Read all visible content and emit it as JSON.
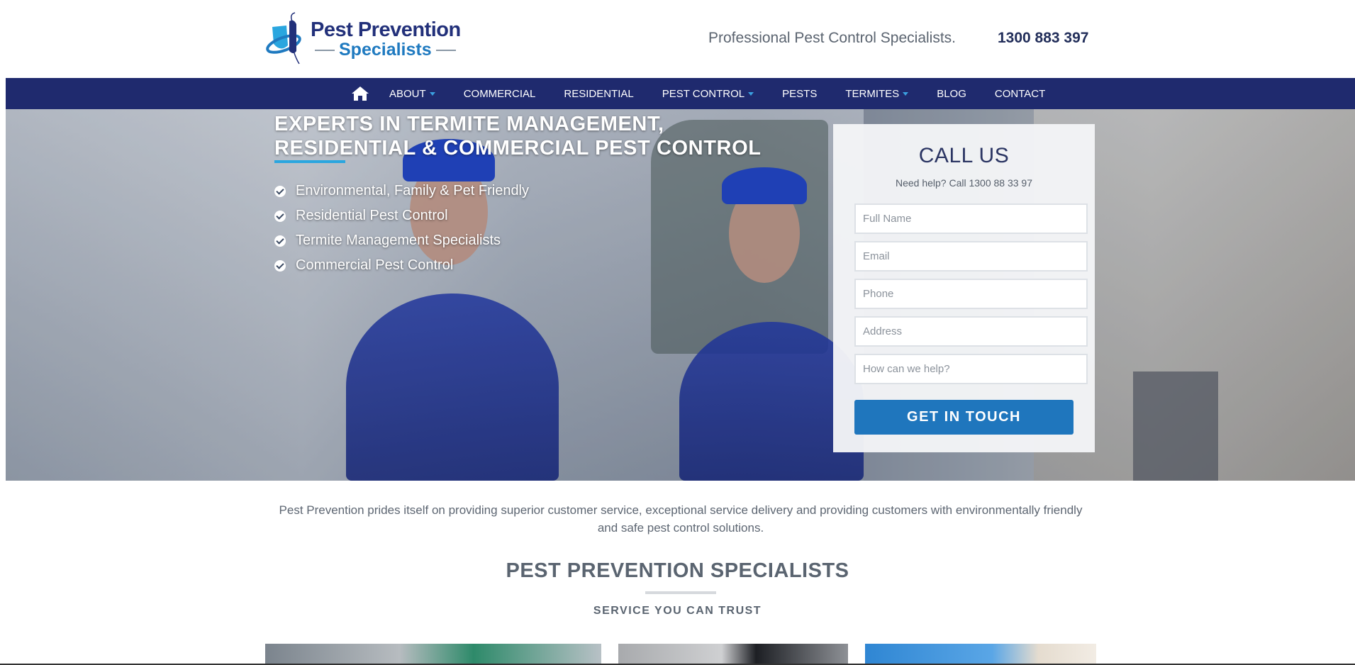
{
  "header": {
    "logo_line1": "Pest Prevention",
    "logo_line2": "Specialists",
    "tagline": "Professional Pest Control Specialists.",
    "phone": "1300 883 397"
  },
  "nav": {
    "home_icon": "home-icon",
    "items": [
      {
        "label": "ABOUT",
        "dropdown": true
      },
      {
        "label": "COMMERCIAL",
        "dropdown": false
      },
      {
        "label": "RESIDENTIAL",
        "dropdown": false
      },
      {
        "label": "PEST CONTROL",
        "dropdown": true
      },
      {
        "label": "PESTS",
        "dropdown": false
      },
      {
        "label": "TERMITES",
        "dropdown": true
      },
      {
        "label": "BLOG",
        "dropdown": false
      },
      {
        "label": "CONTACT",
        "dropdown": false
      }
    ]
  },
  "hero": {
    "heading_line1": "EXPERTS IN TERMITE MANAGEMENT,",
    "heading_line2": "RESIDENTIAL & COMMERCIAL PEST CONTROL",
    "features": [
      "Environmental, Family & Pet Friendly",
      "Residential Pest Control",
      "Termite Management Specialists",
      "Commercial Pest Control"
    ]
  },
  "contact_form": {
    "title": "CALL US",
    "subtitle": "Need help? Call 1300 88 33 97",
    "fields": {
      "name_placeholder": "Full Name",
      "email_placeholder": "Email",
      "phone_placeholder": "Phone",
      "address_placeholder": "Address",
      "message_placeholder": "How can we help?"
    },
    "submit_label": "GET IN TOUCH"
  },
  "intro": {
    "text": "Pest Prevention prides itself on providing superior customer service, exceptional service delivery and providing customers with environmentally friendly and safe pest control solutions."
  },
  "section": {
    "title": "PEST PREVENTION SPECIALISTS",
    "subtitle": "SERVICE YOU CAN TRUST"
  },
  "colors": {
    "nav_background": "#1f2a6e",
    "brand_navy": "#22307a",
    "brand_blue": "#1f7ac0",
    "accent_cyan": "#2aa6df",
    "button_blue": "#1f76bd"
  }
}
